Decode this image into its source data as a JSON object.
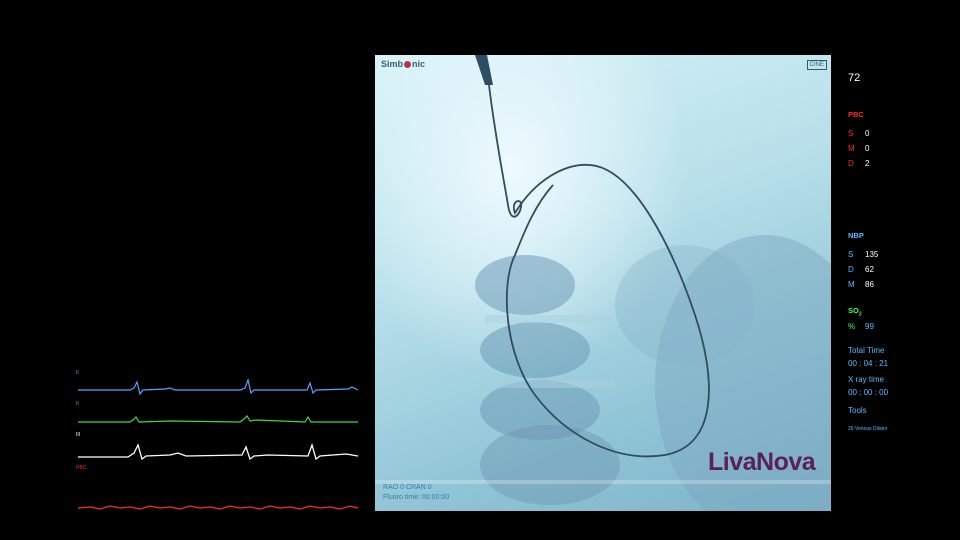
{
  "ecg": {
    "leads": [
      {
        "label": "II",
        "color": "#5aa0ff"
      },
      {
        "label": "II",
        "color": "#3fd64c"
      },
      {
        "label": "III",
        "color": "#ffffff"
      },
      {
        "label": "PBC",
        "color": "#ff3030"
      }
    ]
  },
  "fluoro": {
    "logo_left": "Simb",
    "logo_right": "nic",
    "cine_badge": "CINE",
    "projection": "RAO  0 CRAN  0",
    "fluoro_time": "Fluoro time:  00:00:00",
    "brand": "LivaNova"
  },
  "vitals": {
    "heart_rate": "72",
    "pbc": {
      "title": "PBC",
      "rows": [
        {
          "label": "S",
          "value": "0"
        },
        {
          "label": "M",
          "value": "0"
        },
        {
          "label": "D",
          "value": "2"
        }
      ]
    },
    "nbp": {
      "title": "NBP",
      "rows": [
        {
          "label": "S",
          "value": "135"
        },
        {
          "label": "D",
          "value": "62"
        },
        {
          "label": "M",
          "value": "86"
        }
      ]
    },
    "spo2": {
      "title": "SO",
      "sub": "2",
      "label": "%",
      "value": "99"
    },
    "total_time": {
      "title": "Total Time",
      "value": "00 : 04 : 21"
    },
    "xray_time": {
      "title": "X ray time",
      "value": "00 : 00 : 00"
    },
    "tools": {
      "title": "Tools",
      "item": "26 Venous Dilator"
    }
  },
  "colors": {
    "pbc": "#ff2a2a",
    "nbp": "#5ab8ff",
    "spo2": "#39ff6a",
    "brand": "#5b2157"
  }
}
